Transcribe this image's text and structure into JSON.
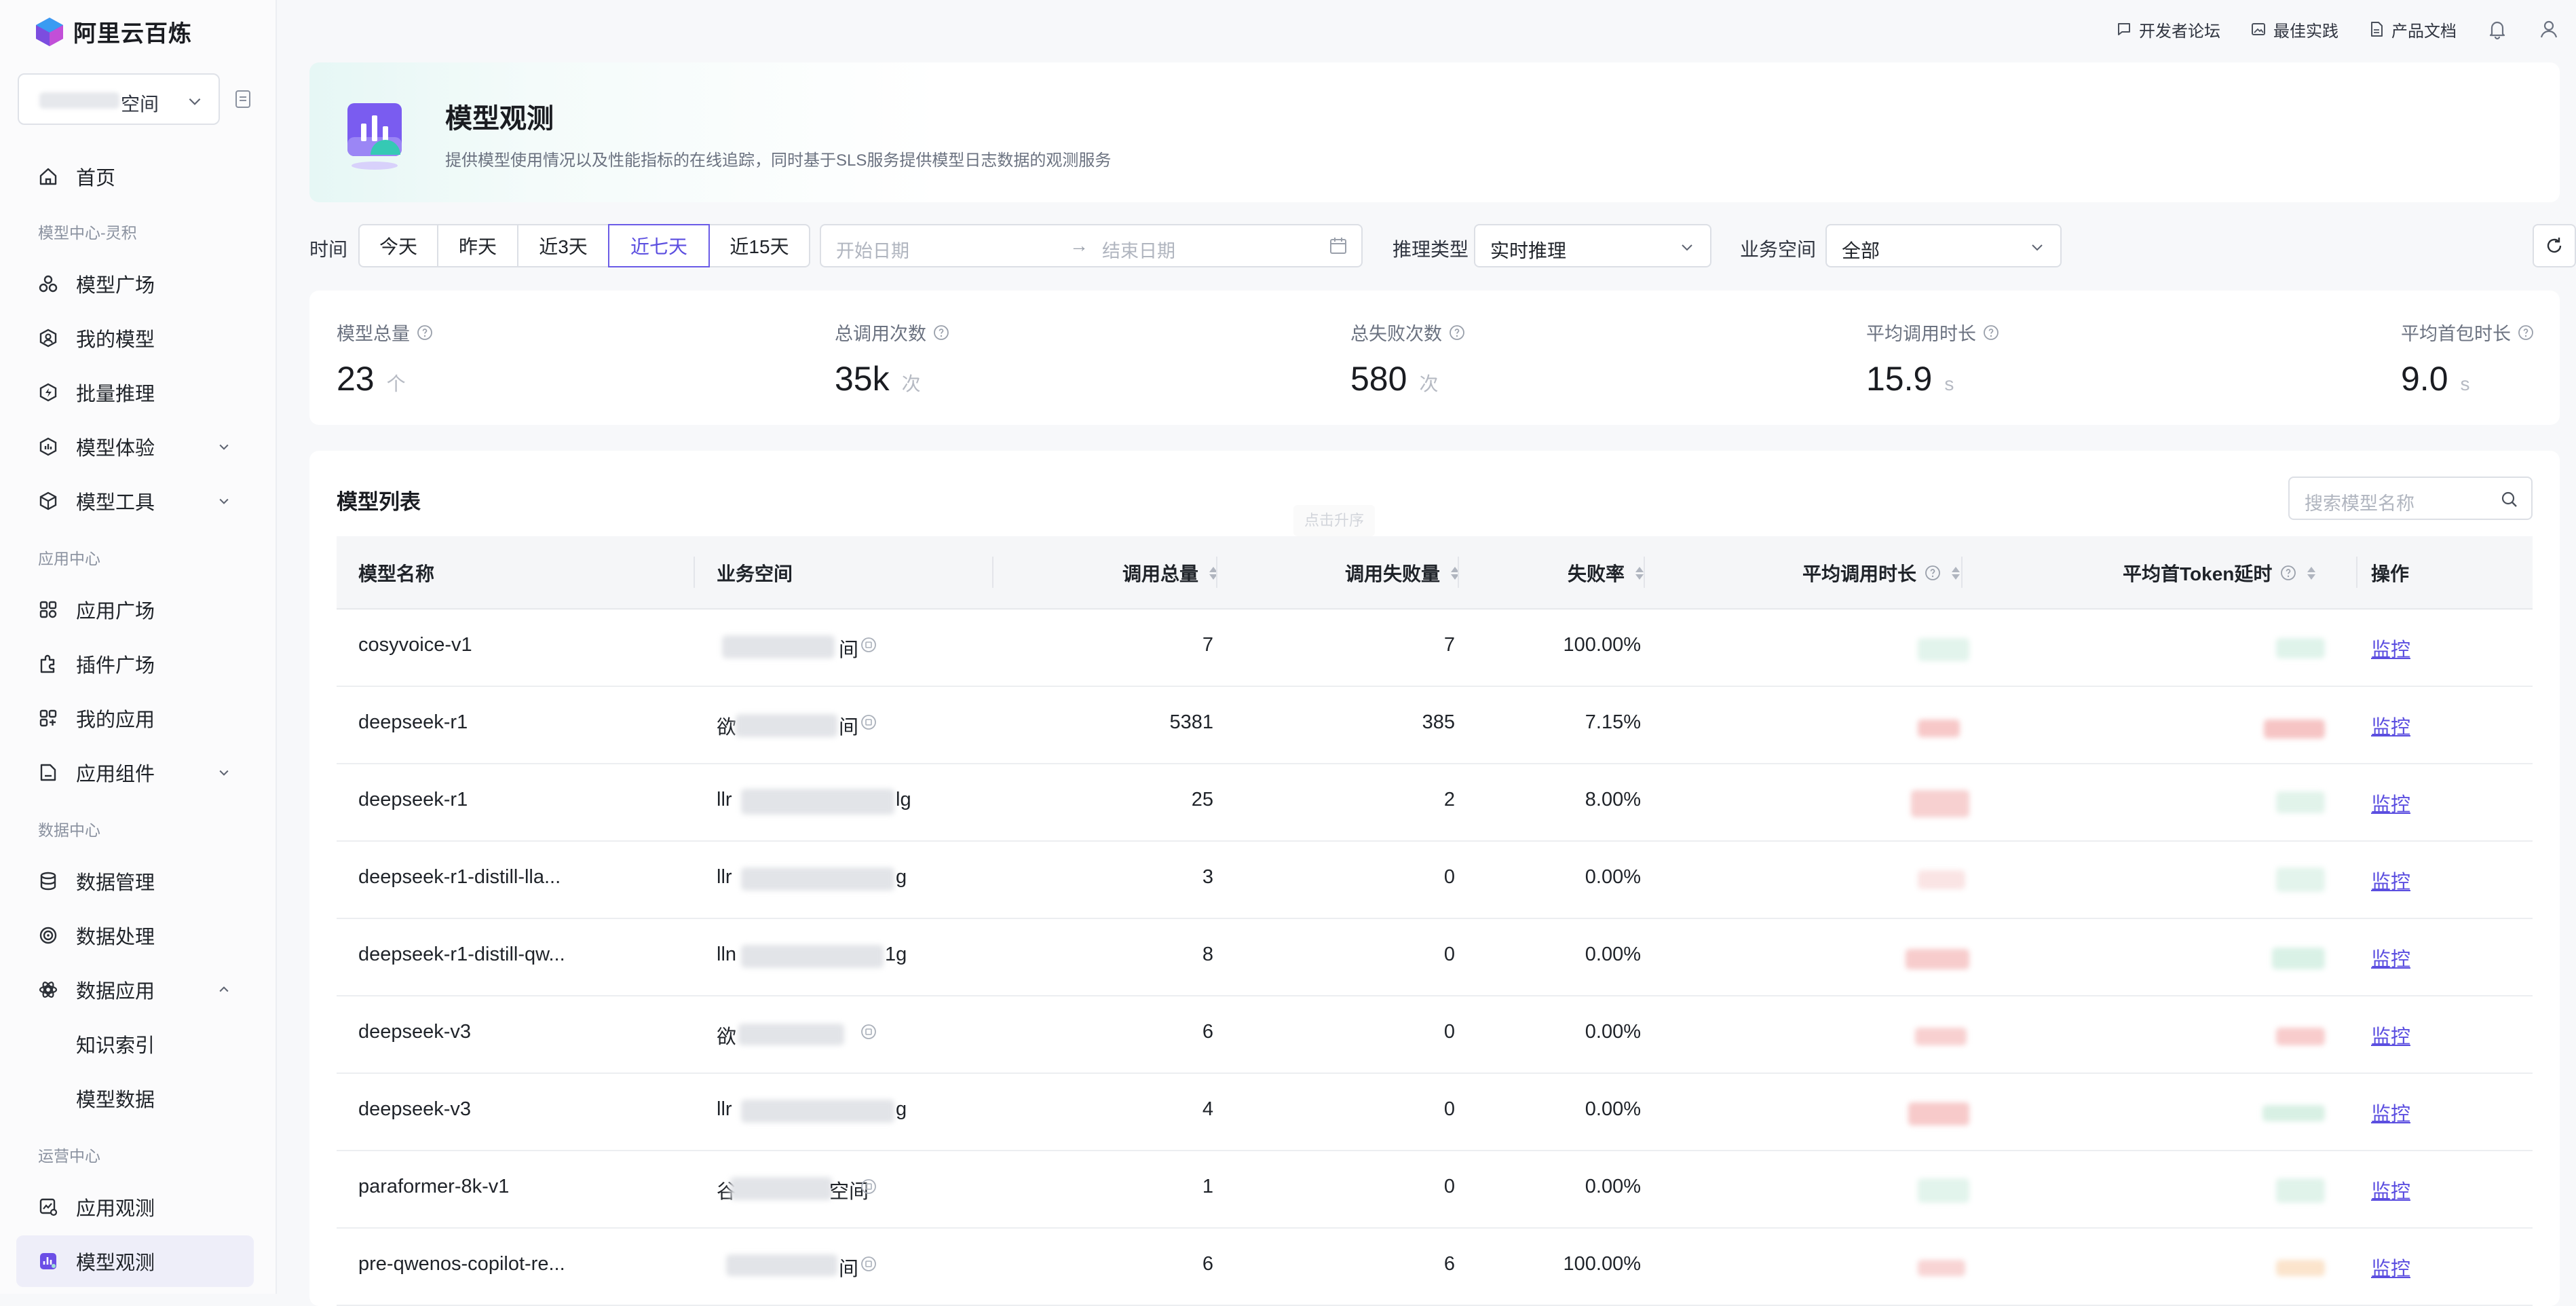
{
  "app": {
    "brand": "阿里云百炼"
  },
  "topnav": {
    "forum": "开发者论坛",
    "best": "最佳实践",
    "docs": "产品文档"
  },
  "workspace": {
    "suffix": "空间"
  },
  "sidebar": {
    "home": "首页",
    "sec_model": "模型中心-灵积",
    "model_square": "模型广场",
    "my_models": "我的模型",
    "batch": "批量推理",
    "model_exp": "模型体验",
    "model_tools": "模型工具",
    "sec_app": "应用中心",
    "app_square": "应用广场",
    "plugin_square": "插件广场",
    "my_apps": "我的应用",
    "app_components": "应用组件",
    "sec_data": "数据中心",
    "data_mgmt": "数据管理",
    "data_proc": "数据处理",
    "data_app": "数据应用",
    "kb_index": "知识索引",
    "model_data": "模型数据",
    "sec_ops": "运营中心",
    "app_obs": "应用观测",
    "model_obs": "模型观测"
  },
  "hero": {
    "title": "模型观测",
    "desc": "提供模型使用情况以及性能指标的在线追踪，同时基于SLS服务提供模型日志数据的观测服务"
  },
  "filters": {
    "time_label": "时间",
    "ranges": [
      "今天",
      "昨天",
      "近3天",
      "近七天",
      "近15天"
    ],
    "active_range": "近七天",
    "start_ph": "开始日期",
    "end_ph": "结束日期",
    "arrow": "→",
    "infer_label": "推理类型",
    "infer_value": "实时推理",
    "space_label": "业务空间",
    "space_value": "全部"
  },
  "stats": [
    {
      "label": "模型总量",
      "value": "23",
      "unit": "个"
    },
    {
      "label": "总调用次数",
      "value": "35k",
      "unit": "次"
    },
    {
      "label": "总失败次数",
      "value": "580",
      "unit": "次"
    },
    {
      "label": "平均调用时长",
      "value": "15.9",
      "unit": "s"
    },
    {
      "label": "平均首包时长",
      "value": "9.0",
      "unit": "s"
    }
  ],
  "table": {
    "title": "模型列表",
    "search_ph": "搜索模型名称",
    "sort_tip": "点击升序",
    "headers": {
      "name": "模型名称",
      "space": "业务空间",
      "calls": "调用总量",
      "fails": "调用失败量",
      "rate": "失败率",
      "avg": "平均调用时长",
      "ttft": "平均首Token延时",
      "op": "操作"
    },
    "op_label": "监控",
    "rows": [
      {
        "name": "cosyvoice-v1",
        "space_pre": "",
        "space_suf": "间",
        "calls": "7",
        "fails": "7",
        "rate": "100.00%"
      },
      {
        "name": "deepseek-r1",
        "space_pre": "欲",
        "space_suf": "间",
        "calls": "5381",
        "fails": "385",
        "rate": "7.15%"
      },
      {
        "name": "deepseek-r1",
        "space_pre": "llr",
        "space_suf": "lg",
        "calls": "25",
        "fails": "2",
        "rate": "8.00%"
      },
      {
        "name": "deepseek-r1-distill-lla...",
        "space_pre": "llr",
        "space_suf": "g",
        "calls": "3",
        "fails": "0",
        "rate": "0.00%"
      },
      {
        "name": "deepseek-r1-distill-qw...",
        "space_pre": "lln",
        "space_suf": "1g",
        "calls": "8",
        "fails": "0",
        "rate": "0.00%"
      },
      {
        "name": "deepseek-v3",
        "space_pre": "欲",
        "space_suf": "",
        "calls": "6",
        "fails": "0",
        "rate": "0.00%"
      },
      {
        "name": "deepseek-v3",
        "space_pre": "llr",
        "space_suf": "g",
        "calls": "4",
        "fails": "0",
        "rate": "0.00%"
      },
      {
        "name": "paraformer-8k-v1",
        "space_pre": "谷",
        "space_suf": "空间",
        "calls": "1",
        "fails": "0",
        "rate": "0.00%"
      },
      {
        "name": "pre-qwenos-copilot-re...",
        "space_pre": "",
        "space_suf": "间",
        "calls": "6",
        "fails": "6",
        "rate": "100.00%"
      }
    ]
  }
}
